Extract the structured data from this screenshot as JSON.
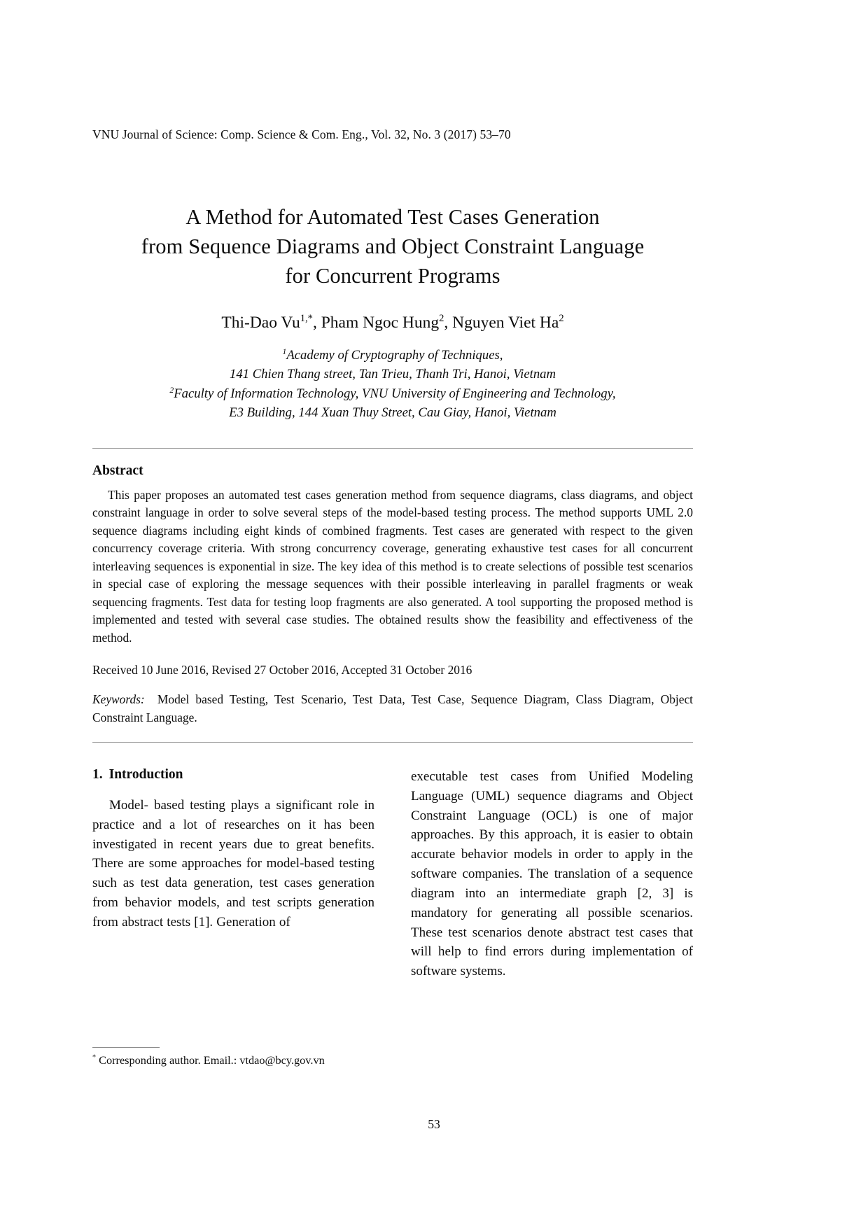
{
  "running_head": "VNU Journal of Science: Comp. Science & Com. Eng., Vol. 32, No. 3 (2017) 53–70",
  "title": {
    "line1": "A Method for Automated Test Cases Generation",
    "line2": "from Sequence Diagrams and Object Constraint Language",
    "line3": "for Concurrent Programs"
  },
  "authors": {
    "a1_name": "Thi-Dao Vu",
    "a1_sup": "1,*",
    "sep1": ", ",
    "a2_name": "Pham Ngoc Hung",
    "a2_sup": "2",
    "sep2": ", ",
    "a3_name": "Nguyen Viet Ha",
    "a3_sup": "2"
  },
  "affiliations": {
    "aff1_sup": "1",
    "aff1_line1": "Academy of Cryptography of Techniques,",
    "aff1_line2": "141 Chien Thang street, Tan Trieu, Thanh Tri, Hanoi, Vietnam",
    "aff2_sup": "2",
    "aff2_line1": "Faculty of Information Technology, VNU University of Engineering and Technology,",
    "aff2_line2": "E3 Building, 144 Xuan Thuy Street, Cau Giay, Hanoi, Vietnam"
  },
  "abstract": {
    "heading": "Abstract",
    "body": "This paper proposes an automated test cases generation method from sequence diagrams, class diagrams, and object constraint language in order to solve several steps of the model-based testing process. The method supports UML 2.0 sequence diagrams including eight kinds of combined fragments. Test cases are generated with respect to the given concurrency coverage criteria. With strong concurrency coverage, generating exhaustive test cases for all concurrent interleaving sequences is exponential in size. The key idea of this method is to create selections of possible test scenarios in special case of exploring the message sequences with their possible interleaving in parallel fragments or weak sequencing fragments. Test data for testing loop fragments are also generated. A tool supporting the proposed method is implemented and tested with several case studies. The obtained results show the feasibility and effectiveness of the method."
  },
  "received": "Received 10 June 2016, Revised 27 October 2016, Accepted 31 October 2016",
  "keywords": {
    "label": "Keywords:",
    "text": "Model based Testing, Test Scenario, Test Data, Test Case, Sequence Diagram, Class Diagram, Object Constraint Language."
  },
  "introduction": {
    "number": "1.",
    "heading": "Introduction",
    "paragraph_left": "Model- based testing plays a significant role in practice and a lot of researches on it has been investigated in recent years due to great benefits. There are some approaches for model-based testing such as test data generation, test cases generation from behavior models, and test scripts generation from abstract tests [1]. Generation of",
    "paragraph_right": "executable test cases from Unified Modeling Language (UML) sequence diagrams and Object Constraint Language (OCL) is one of major approaches. By this approach, it is easier to obtain accurate behavior models in order to apply in the software companies. The translation of a sequence diagram into an intermediate graph [2, 3] is mandatory for generating all possible scenarios. These test scenarios denote abstract test cases that will help to find errors during implementation of software systems."
  },
  "footnote": {
    "marker": "*",
    "text": " Corresponding author. Email.: vtdao@bcy.gov.vn"
  },
  "page_number": "53"
}
